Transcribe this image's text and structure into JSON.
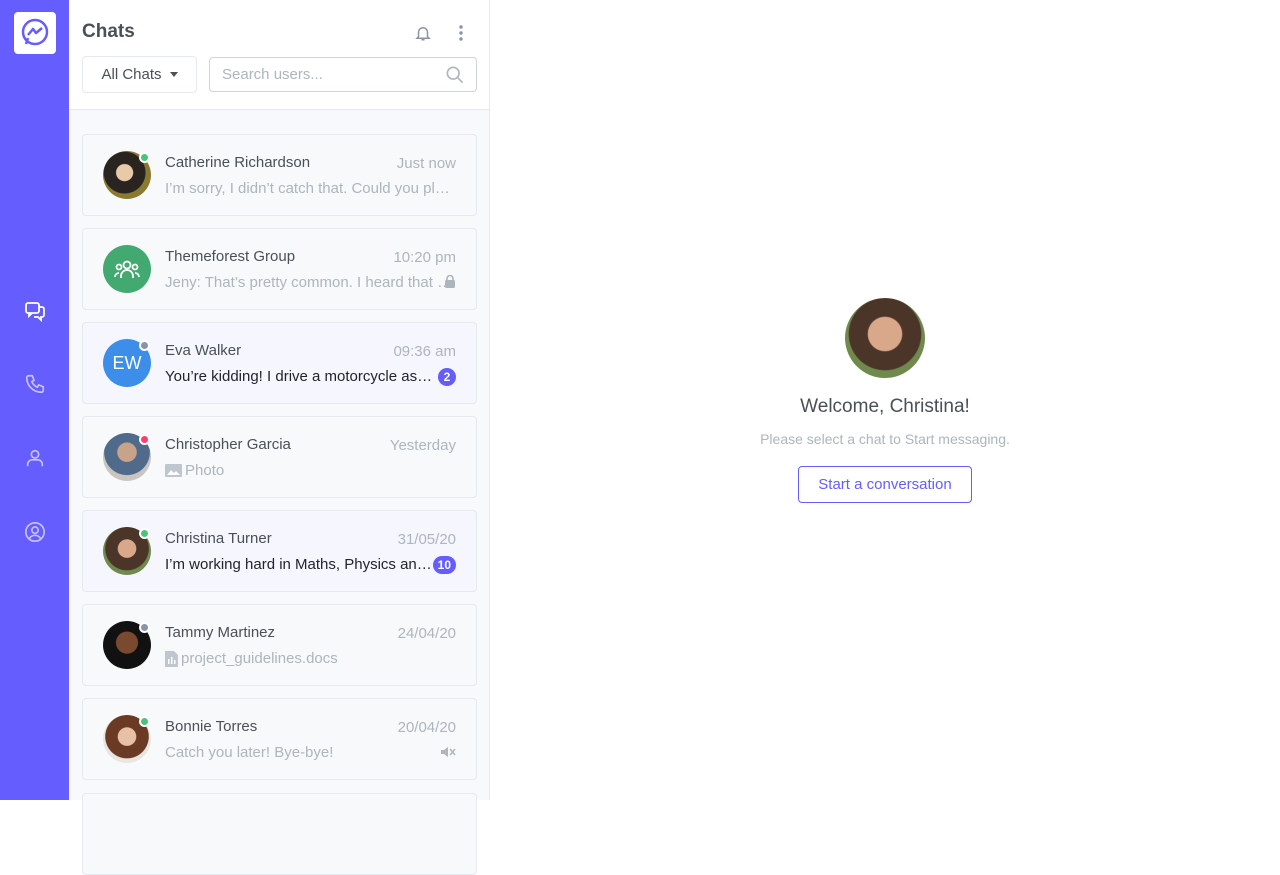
{
  "nav": {
    "items": [
      {
        "icon": "chat-icon",
        "active": true
      },
      {
        "icon": "phone-icon"
      },
      {
        "icon": "users-icon"
      },
      {
        "icon": "user-circle-icon"
      }
    ],
    "accent": "#665dfe"
  },
  "panel": {
    "title": "Chats",
    "filter": "All Chats",
    "search_placeholder": "Search users...",
    "chats": [
      {
        "name": "Catherine Richardson",
        "time": "Just now",
        "message": "I’m sorry, I didn’t catch that. Could you please repeat?",
        "status": "online",
        "avatar": "photo"
      },
      {
        "name": "Themeforest Group",
        "time": "10:20 pm",
        "message": "Jeny: That’s pretty common. I heard that a lot of people had the same experience.",
        "avatar": "group",
        "icon": "lock-icon"
      },
      {
        "name": "Eva Walker",
        "time": "09:36 am",
        "message": "You’re kidding! I drive a motorcycle as well",
        "status": "away",
        "initials": "EW",
        "unread": "2"
      },
      {
        "name": "Christopher Garcia",
        "time": "Yesterday",
        "message": "Photo",
        "status": "busy",
        "avatar": "photo",
        "attachment": "image-icon"
      },
      {
        "name": "Christina Turner",
        "time": "31/05/20",
        "message": "I’m working hard in Maths, Physics and Chemistry",
        "status": "online",
        "avatar": "photo",
        "unread": "10"
      },
      {
        "name": "Tammy Martinez",
        "time": "24/04/20",
        "message": "project_guidelines.docs",
        "status": "away",
        "avatar": "photo",
        "attachment": "file-icon"
      },
      {
        "name": "Bonnie Torres",
        "time": "20/04/20",
        "message": "Catch you later! Bye-bye!",
        "status": "online",
        "avatar": "photo",
        "icon": "mute-icon"
      }
    ]
  },
  "welcome": {
    "title": "Welcome, Christina!",
    "subtitle": "Please select a chat to Start messaging.",
    "button": "Start a conversation"
  }
}
